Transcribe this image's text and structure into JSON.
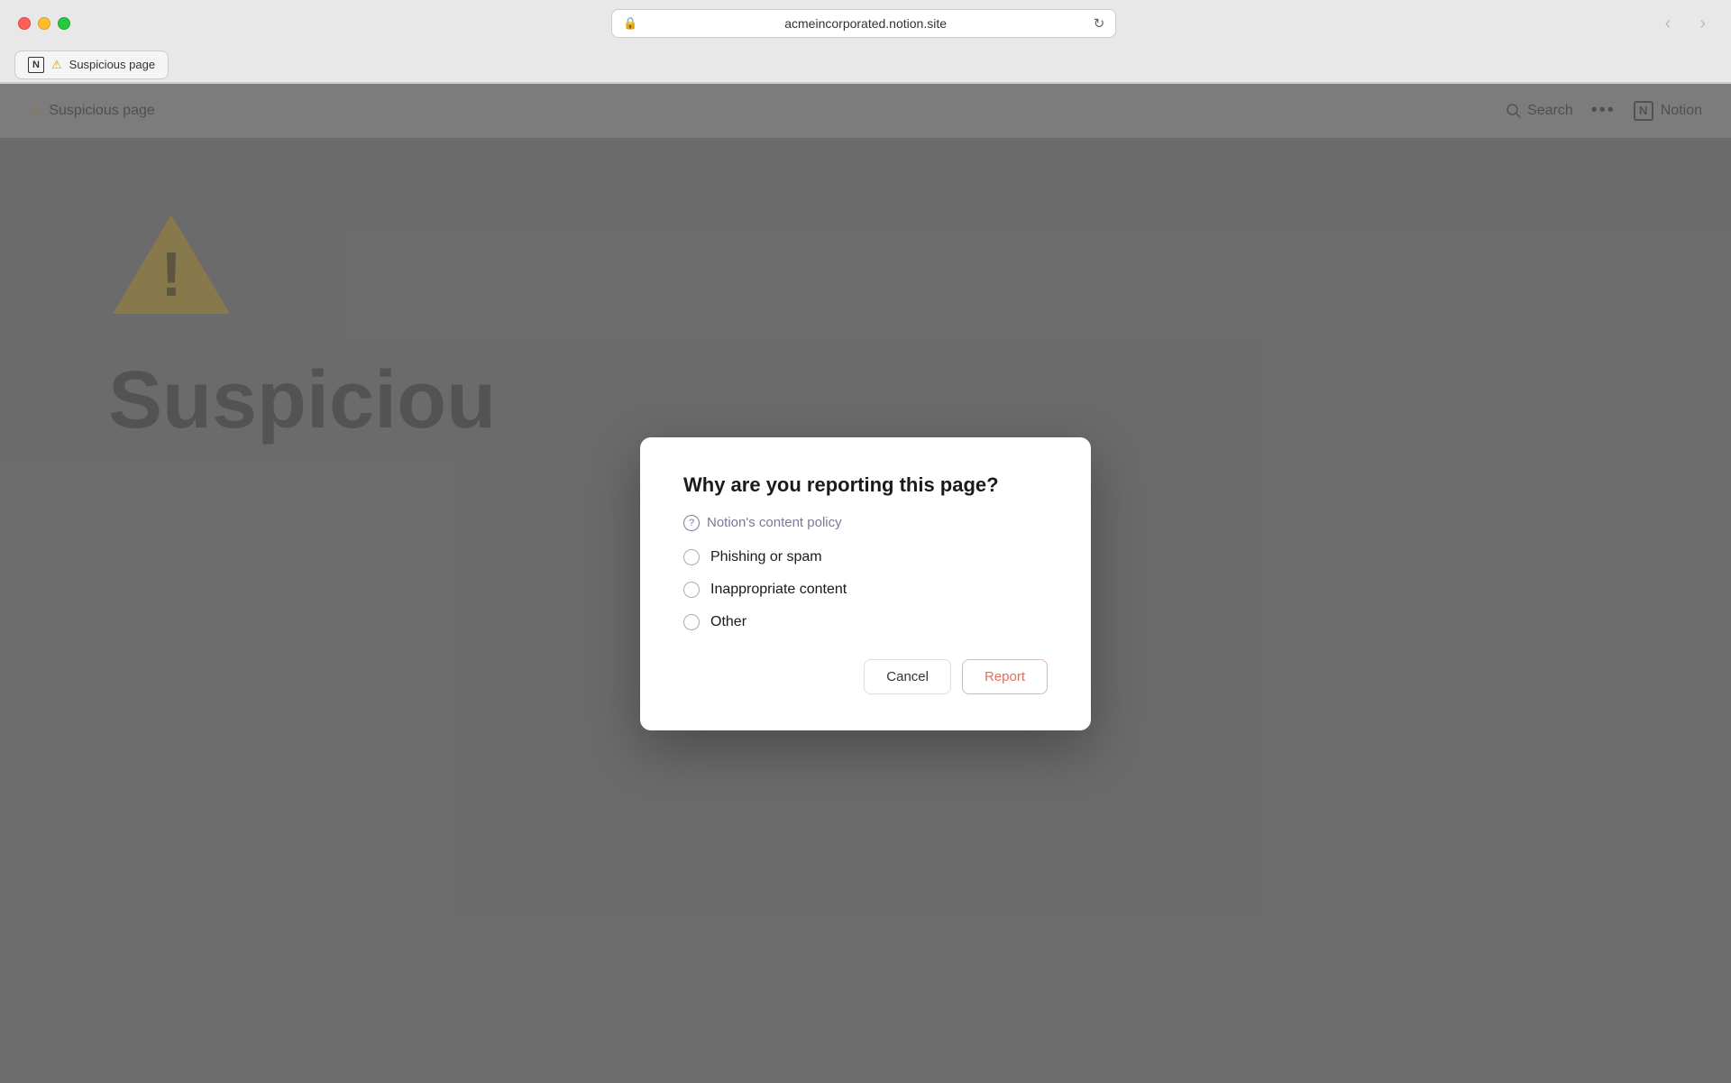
{
  "browser": {
    "url": "acmeincorporated.notion.site",
    "back_button": "‹",
    "forward_button": "›",
    "reload_icon": "↻"
  },
  "tab": {
    "label": "Suspicious page",
    "warning_icon": "⚠"
  },
  "topbar": {
    "page_title": "Suspicious page",
    "warning_icon": "⚠",
    "search_label": "Search",
    "more_icon": "•••",
    "notion_label": "Notion",
    "notion_icon": "N"
  },
  "background": {
    "suspicious_text": "Suspiciou",
    "warning_icon": "!"
  },
  "modal": {
    "title": "Why are you reporting this page?",
    "content_policy_label": "Notion's content policy",
    "options": [
      {
        "id": "phishing",
        "label": "Phishing or spam"
      },
      {
        "id": "inappropriate",
        "label": "Inappropriate content"
      },
      {
        "id": "other",
        "label": "Other"
      }
    ],
    "cancel_label": "Cancel",
    "report_label": "Report"
  },
  "icons": {
    "lock": "🔒",
    "question_mark": "?",
    "warning": "⚠"
  }
}
